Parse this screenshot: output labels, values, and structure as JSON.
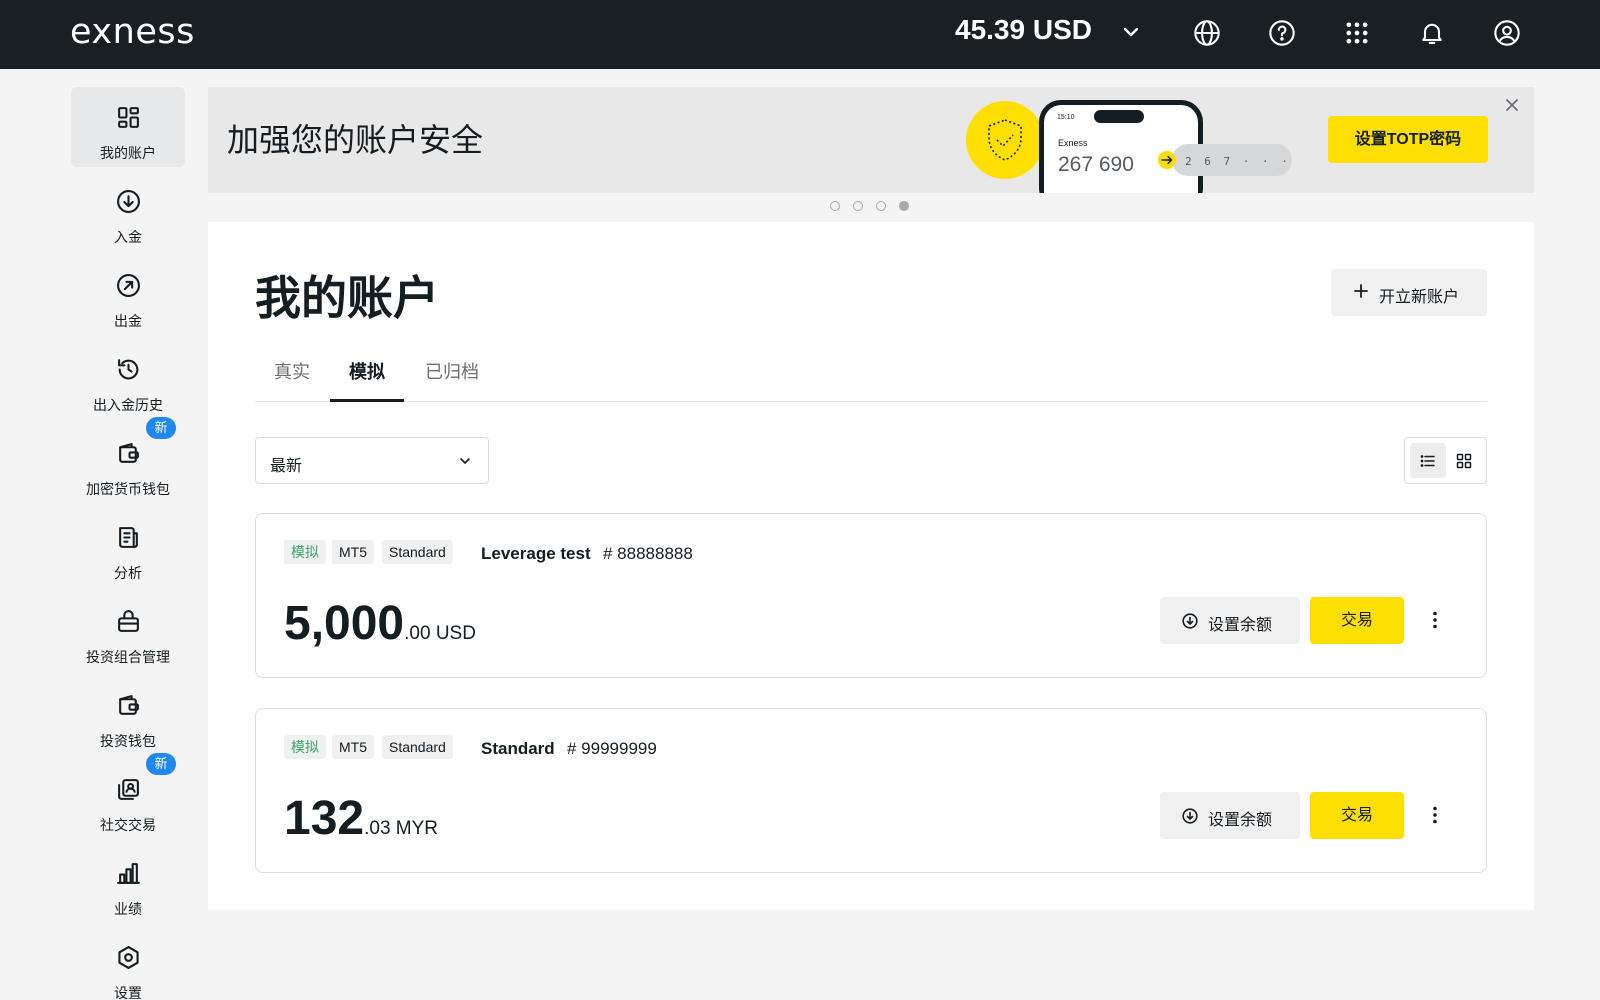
{
  "header": {
    "logo": "exness",
    "balance": "45.39 USD",
    "icons": [
      "globe-icon",
      "help-icon",
      "apps-icon",
      "bell-icon",
      "profile-icon"
    ]
  },
  "sidebar": {
    "items": [
      {
        "label": "我的账户",
        "icon": "dashboard-icon",
        "active": true
      },
      {
        "label": "入金",
        "icon": "deposit-icon"
      },
      {
        "label": "出金",
        "icon": "withdraw-icon"
      },
      {
        "label": "出入金历史",
        "icon": "history-icon"
      },
      {
        "label": "加密货币钱包",
        "icon": "wallet-icon",
        "badge": "新"
      },
      {
        "label": "分析",
        "icon": "analytics-icon"
      },
      {
        "label": "投资组合管理",
        "icon": "portfolio-icon"
      },
      {
        "label": "投资钱包",
        "icon": "investment-wallet-icon"
      },
      {
        "label": "社交交易",
        "icon": "social-trading-icon",
        "badge": "新"
      },
      {
        "label": "业绩",
        "icon": "performance-icon"
      },
      {
        "label": "设置",
        "icon": "settings-icon"
      }
    ]
  },
  "banner": {
    "title": "加强您的账户安全",
    "phone_time": "15:10",
    "phone_brand": "Exness",
    "phone_code": "267 690",
    "code_digits": "2 6 7 · · ·",
    "cta": "设置TOTP密码",
    "slides": 4,
    "active_slide": 4
  },
  "main": {
    "title": "我的账户",
    "new_account_button": "开立新账户",
    "tabs": [
      {
        "label": "真实",
        "active": false
      },
      {
        "label": "模拟",
        "active": true
      },
      {
        "label": "已归档",
        "active": false
      }
    ],
    "sort_value": "最新",
    "accounts": [
      {
        "tags": [
          "模拟",
          "MT5",
          "Standard"
        ],
        "name": "Leverage test",
        "number": "# 88888888",
        "amount_int": "5,000",
        "amount_dec": ".00 USD",
        "set_balance_label": "设置余额",
        "trade_label": "交易"
      },
      {
        "tags": [
          "模拟",
          "MT5",
          "Standard"
        ],
        "name": "Standard",
        "number": "# 99999999",
        "amount_int": "132",
        "amount_dec": ".03 MYR",
        "set_balance_label": "设置余额",
        "trade_label": "交易"
      }
    ]
  },
  "colors": {
    "header_bg": "#1a1f24",
    "accent_yellow": "#ffde02",
    "badge_blue": "#1e88f0",
    "demo_green": "#3aa56b"
  }
}
